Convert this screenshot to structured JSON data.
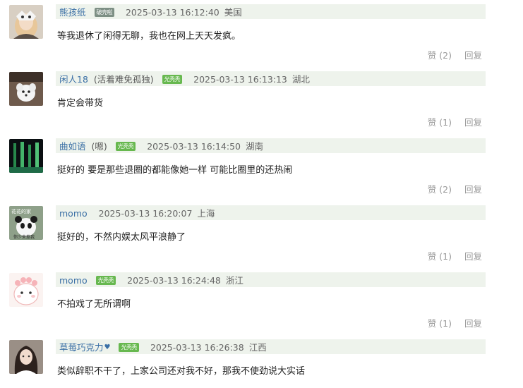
{
  "comments": [
    {
      "username": "熊孩纸",
      "note": "",
      "heart": "",
      "badge": "破壳啦",
      "badge_color": "#7d8f84",
      "time": "2025-03-13 16:12:40",
      "location": "美国",
      "text": "等我退休了闲得无聊，我也在网上天天发疯。",
      "like_label": "赞 (2)",
      "reply_label": "回复",
      "avatar": "avatar-girl-mask"
    },
    {
      "username": "闲人18",
      "note": "(活着难免孤独)",
      "heart": "",
      "badge": "光秃秃",
      "badge_color": "#67b84f",
      "time": "2025-03-13 16:13:13",
      "location": "湖北",
      "text": "肯定会带货",
      "like_label": "赞 (1)",
      "reply_label": "回复",
      "avatar": "avatar-white-dog"
    },
    {
      "username": "曲如语",
      "note": "(嗯)",
      "heart": "",
      "badge": "光秃秃",
      "badge_color": "#67b84f",
      "time": "2025-03-13 16:14:50",
      "location": "湖南",
      "text": "挺好的 要是那些退圈的都能像她一样 可能比圈里的还热闹",
      "like_label": "赞 (2)",
      "reply_label": "回复",
      "avatar": "avatar-green-lights"
    },
    {
      "username": "momo",
      "note": "",
      "heart": "",
      "badge": "",
      "badge_color": "",
      "time": "2025-03-13 16:20:07",
      "location": "上海",
      "text": "挺好的，不然内娱太风平浪静了",
      "like_label": "赞 (1)",
      "reply_label": "回复",
      "avatar": "avatar-panda"
    },
    {
      "username": "momo",
      "note": "",
      "heart": "",
      "badge": "光秃秃",
      "badge_color": "#67b84f",
      "time": "2025-03-13 16:24:48",
      "location": "浙江",
      "text": "不拍戏了无所谓啊",
      "like_label": "赞 (1)",
      "reply_label": "回复",
      "avatar": "avatar-pink-creature"
    },
    {
      "username": "草莓巧克力",
      "note": "",
      "heart": "♥",
      "badge": "光秃秃",
      "badge_color": "#67b84f",
      "time": "2025-03-13 16:26:38",
      "location": "江西",
      "text": "类似辞职不干了，上家公司还对我不好，那我不使劲说大实话",
      "like_label": "",
      "reply_label": "",
      "avatar": "avatar-dark-hair-girl"
    }
  ],
  "avatar_texts": {
    "panda_top": "花花的家",
    "panda_bottom": "你少来惹我"
  }
}
